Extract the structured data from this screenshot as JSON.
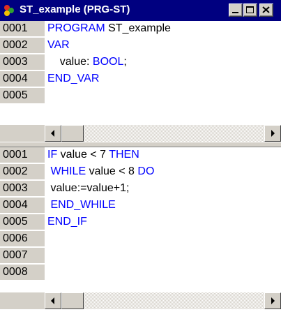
{
  "window": {
    "title": "ST_example (PRG-ST)",
    "controls": [
      "minimize",
      "maximize",
      "close"
    ]
  },
  "declaration_pane": {
    "lines": [
      {
        "num": "0001",
        "tokens": [
          {
            "t": "PROGRAM",
            "kw": true
          },
          {
            "t": " ST_example",
            "kw": false
          }
        ]
      },
      {
        "num": "0002",
        "tokens": [
          {
            "t": "VAR",
            "kw": true
          }
        ]
      },
      {
        "num": "0003",
        "tokens": [
          {
            "t": "    value: ",
            "kw": false
          },
          {
            "t": "BOOL",
            "kw": true
          },
          {
            "t": ";",
            "kw": false
          }
        ]
      },
      {
        "num": "0004",
        "tokens": [
          {
            "t": "END_VAR",
            "kw": true
          }
        ]
      },
      {
        "num": "0005",
        "tokens": []
      }
    ]
  },
  "body_pane": {
    "lines": [
      {
        "num": "0001",
        "tokens": [
          {
            "t": "IF",
            "kw": true
          },
          {
            "t": " value < 7 ",
            "kw": false
          },
          {
            "t": "THEN",
            "kw": true
          }
        ]
      },
      {
        "num": "0002",
        "tokens": [
          {
            "t": " WHILE",
            "kw": true
          },
          {
            "t": " value < 8 ",
            "kw": false
          },
          {
            "t": "DO",
            "kw": true
          }
        ]
      },
      {
        "num": "0003",
        "tokens": [
          {
            "t": " value:=value+1;",
            "kw": false
          }
        ]
      },
      {
        "num": "0004",
        "tokens": [
          {
            "t": " END_WHILE",
            "kw": true
          }
        ]
      },
      {
        "num": "0005",
        "tokens": [
          {
            "t": "END_IF",
            "kw": true
          }
        ]
      },
      {
        "num": "0006",
        "tokens": []
      },
      {
        "num": "0007",
        "tokens": []
      },
      {
        "num": "0008",
        "tokens": []
      }
    ]
  },
  "colors": {
    "keyword": "#0000ff",
    "titlebar": "#000080",
    "chrome": "#d4d0c8"
  }
}
